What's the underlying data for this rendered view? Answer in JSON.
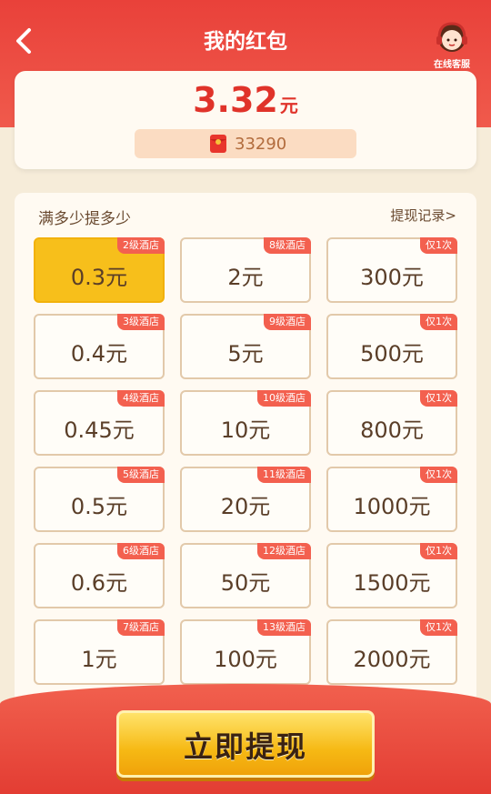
{
  "header": {
    "title": "我的红包",
    "customer_service": "在线客服"
  },
  "balance": {
    "amount": "3.32",
    "unit": "元",
    "coins": "33290"
  },
  "section": {
    "title": "满多少提多少",
    "record_link": "提现记录>"
  },
  "options": [
    [
      {
        "tag": "2级酒店",
        "value": "0.3元",
        "selected": true
      },
      {
        "tag": "8级酒店",
        "value": "2元"
      },
      {
        "tag": "仅1次",
        "value": "300元"
      }
    ],
    [
      {
        "tag": "3级酒店",
        "value": "0.4元"
      },
      {
        "tag": "9级酒店",
        "value": "5元"
      },
      {
        "tag": "仅1次",
        "value": "500元"
      }
    ],
    [
      {
        "tag": "4级酒店",
        "value": "0.45元"
      },
      {
        "tag": "10级酒店",
        "value": "10元"
      },
      {
        "tag": "仅1次",
        "value": "800元"
      }
    ],
    [
      {
        "tag": "5级酒店",
        "value": "0.5元"
      },
      {
        "tag": "11级酒店",
        "value": "20元"
      },
      {
        "tag": "仅1次",
        "value": "1000元"
      }
    ],
    [
      {
        "tag": "6级酒店",
        "value": "0.6元"
      },
      {
        "tag": "12级酒店",
        "value": "50元"
      },
      {
        "tag": "仅1次",
        "value": "1500元"
      }
    ],
    [
      {
        "tag": "7级酒店",
        "value": "1元"
      },
      {
        "tag": "13级酒店",
        "value": "100元"
      },
      {
        "tag": "仅1次",
        "value": "2000元"
      }
    ]
  ],
  "withdraw_button": "立即提现",
  "colors": {
    "header_red": "#e9413a",
    "selected_gold": "#f7bf1b",
    "amount_red": "#e0332a"
  }
}
